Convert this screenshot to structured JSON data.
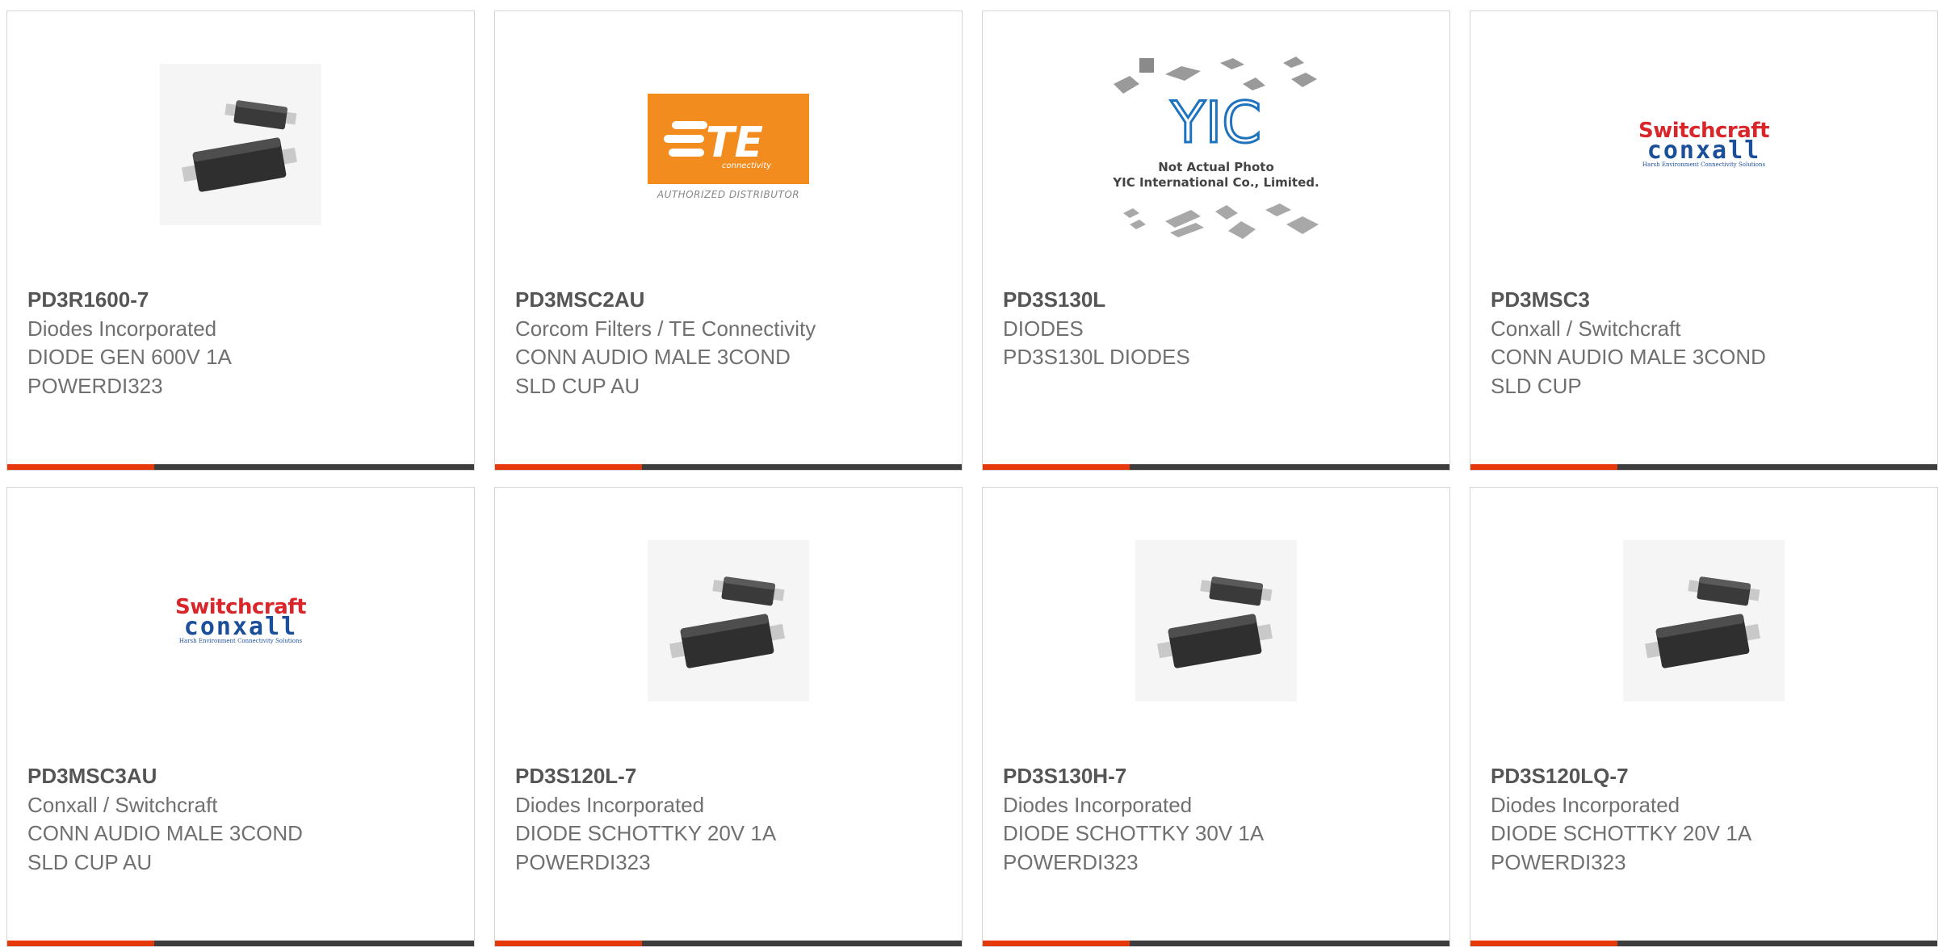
{
  "products": [
    {
      "part_number": "PD3R1600-7",
      "manufacturer": "Diodes Incorporated",
      "description_line1": "DIODE GEN 600V 1A",
      "description_line2": "POWERDI323",
      "image": "diode-package"
    },
    {
      "part_number": "PD3MSC2AU",
      "manufacturer": "Corcom Filters / TE Connectivity",
      "description_line1": "CONN AUDIO MALE 3COND",
      "description_line2": "SLD CUP AU",
      "image": "te-connectivity-logo",
      "logo_text": "connectivity",
      "logo_tagline": "AUTHORIZED DISTRIBUTOR"
    },
    {
      "part_number": "PD3S130L",
      "manufacturer": "DIODES",
      "description_line1": "PD3S130L DIODES",
      "description_line2": "",
      "image": "yic-placeholder",
      "placeholder_line1": "Not Actual Photo",
      "placeholder_line2": "YIC International Co., Limited."
    },
    {
      "part_number": "PD3MSC3",
      "manufacturer": "Conxall / Switchcraft",
      "description_line1": "CONN AUDIO MALE 3COND",
      "description_line2": "SLD CUP",
      "image": "switchcraft-conxall-logo",
      "logo_top": "Switchcraft",
      "logo_mid": "conxall",
      "logo_sub": "Harsh Environment Connectivity Solutions"
    },
    {
      "part_number": "PD3MSC3AU",
      "manufacturer": "Conxall / Switchcraft",
      "description_line1": "CONN AUDIO MALE 3COND",
      "description_line2": "SLD CUP AU",
      "image": "switchcraft-conxall-logo",
      "logo_top": "Switchcraft",
      "logo_mid": "conxall",
      "logo_sub": "Harsh Environment Connectivity Solutions"
    },
    {
      "part_number": "PD3S120L-7",
      "manufacturer": "Diodes Incorporated",
      "description_line1": "DIODE SCHOTTKY 20V 1A",
      "description_line2": "POWERDI323",
      "image": "diode-package"
    },
    {
      "part_number": "PD3S130H-7",
      "manufacturer": "Diodes Incorporated",
      "description_line1": "DIODE SCHOTTKY 30V 1A",
      "description_line2": "POWERDI323",
      "image": "diode-package"
    },
    {
      "part_number": "PD3S120LQ-7",
      "manufacturer": "Diodes Incorporated",
      "description_line1": "DIODE SCHOTTKY 20V 1A",
      "description_line2": "POWERDI323",
      "image": "diode-package"
    }
  ],
  "colors": {
    "accent": "#e5390c",
    "bar": "#3d3d3d",
    "border": "#d6d6d6",
    "text": "#707070",
    "te_orange": "#f28c1e",
    "switchcraft_red": "#d9262b",
    "conxall_blue": "#1c4f9a",
    "yic_blue": "#1e73be"
  }
}
